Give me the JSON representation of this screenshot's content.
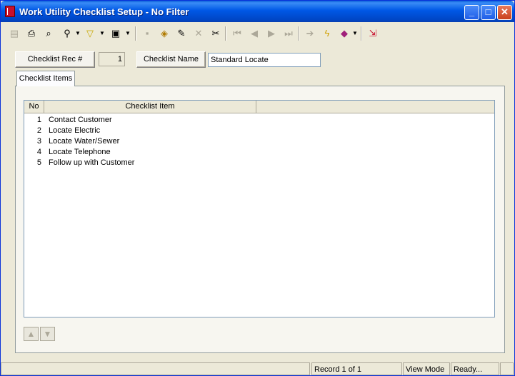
{
  "window": {
    "title": "Work Utility Checklist Setup - No Filter"
  },
  "titlebar_buttons": {
    "minimize": "_",
    "maximize": "□",
    "close": "✕"
  },
  "form": {
    "rec_label": "Checklist Rec #",
    "rec_value": "1",
    "name_label": "Checklist Name",
    "name_value": "Standard Locate"
  },
  "tabs": [
    {
      "label": "Checklist Items"
    }
  ],
  "grid": {
    "columns": [
      "No",
      "Checklist Item"
    ],
    "rows": [
      {
        "no": "1",
        "item": "Contact Customer"
      },
      {
        "no": "2",
        "item": "Locate Electric"
      },
      {
        "no": "3",
        "item": "Locate Water/Sewer"
      },
      {
        "no": "4",
        "item": "Locate Telephone"
      },
      {
        "no": "5",
        "item": "Follow up with Customer"
      }
    ]
  },
  "statusbar": {
    "record": "Record 1 of 1",
    "mode": "View Mode",
    "status": "Ready..."
  }
}
